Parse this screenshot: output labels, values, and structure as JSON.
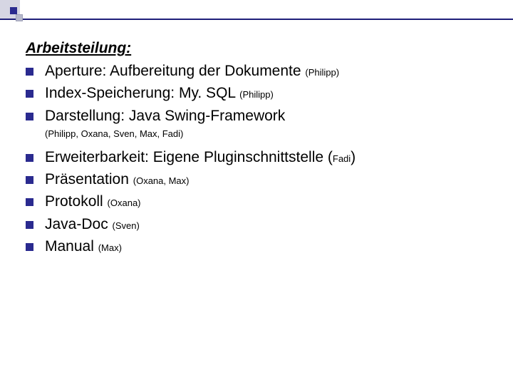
{
  "heading": "Arbeitsteilung:",
  "items1": [
    {
      "text": "Aperture: Aufbereitung der Dokumente ",
      "small": "(Philipp)"
    },
    {
      "text": "Index-Speicherung: My. SQL ",
      "small": "(Philipp)"
    },
    {
      "text": "Darstellung: Java Swing-Framework",
      "small": ""
    }
  ],
  "note": "(Philipp, Oxana, Sven, Max, Fadi)",
  "items2": [
    {
      "text": "Erweiterbarkeit: Eigene Pluginschnittstelle (",
      "small": "Fadi",
      "close": ")"
    },
    {
      "text": "Präsentation ",
      "small": "(Oxana, Max)",
      "close": ""
    },
    {
      "text": "Protokoll ",
      "small": "(Oxana)",
      "close": ""
    },
    {
      "text": "Java-Doc ",
      "small": "(Sven)",
      "close": ""
    },
    {
      "text": "Manual ",
      "small": "(Max)",
      "close": ""
    }
  ]
}
